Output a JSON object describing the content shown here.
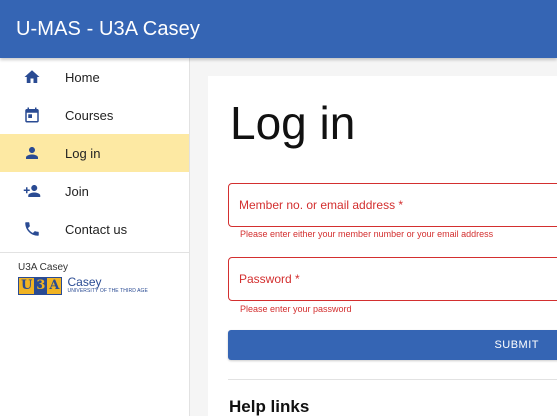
{
  "app": {
    "title": "U-MAS - U3A Casey"
  },
  "sidebar": {
    "items": [
      {
        "label": "Home",
        "icon": "home-icon"
      },
      {
        "label": "Courses",
        "icon": "calendar-icon"
      },
      {
        "label": "Log in",
        "icon": "person-icon",
        "active": true
      },
      {
        "label": "Join",
        "icon": "person-add-icon"
      },
      {
        "label": "Contact us",
        "icon": "phone-icon"
      }
    ],
    "org_name": "U3A Casey",
    "logo": {
      "letters": [
        "U",
        "3",
        "A"
      ],
      "name": "Casey",
      "subtitle": "UNIVERSITY OF THE THIRD AGE"
    }
  },
  "main": {
    "title": "Log in",
    "member_field": {
      "label": "Member no. or email address *",
      "value": "",
      "helper": "Please enter either your member number or your email address"
    },
    "password_field": {
      "label": "Password *",
      "value": "",
      "helper": "Please enter your password"
    },
    "submit_label": "SUBMIT",
    "help_title": "Help links"
  },
  "colors": {
    "primary": "#3565b4",
    "active_bg": "#fde9a3",
    "error": "#d32f2f",
    "icon": "#2a4b93"
  }
}
